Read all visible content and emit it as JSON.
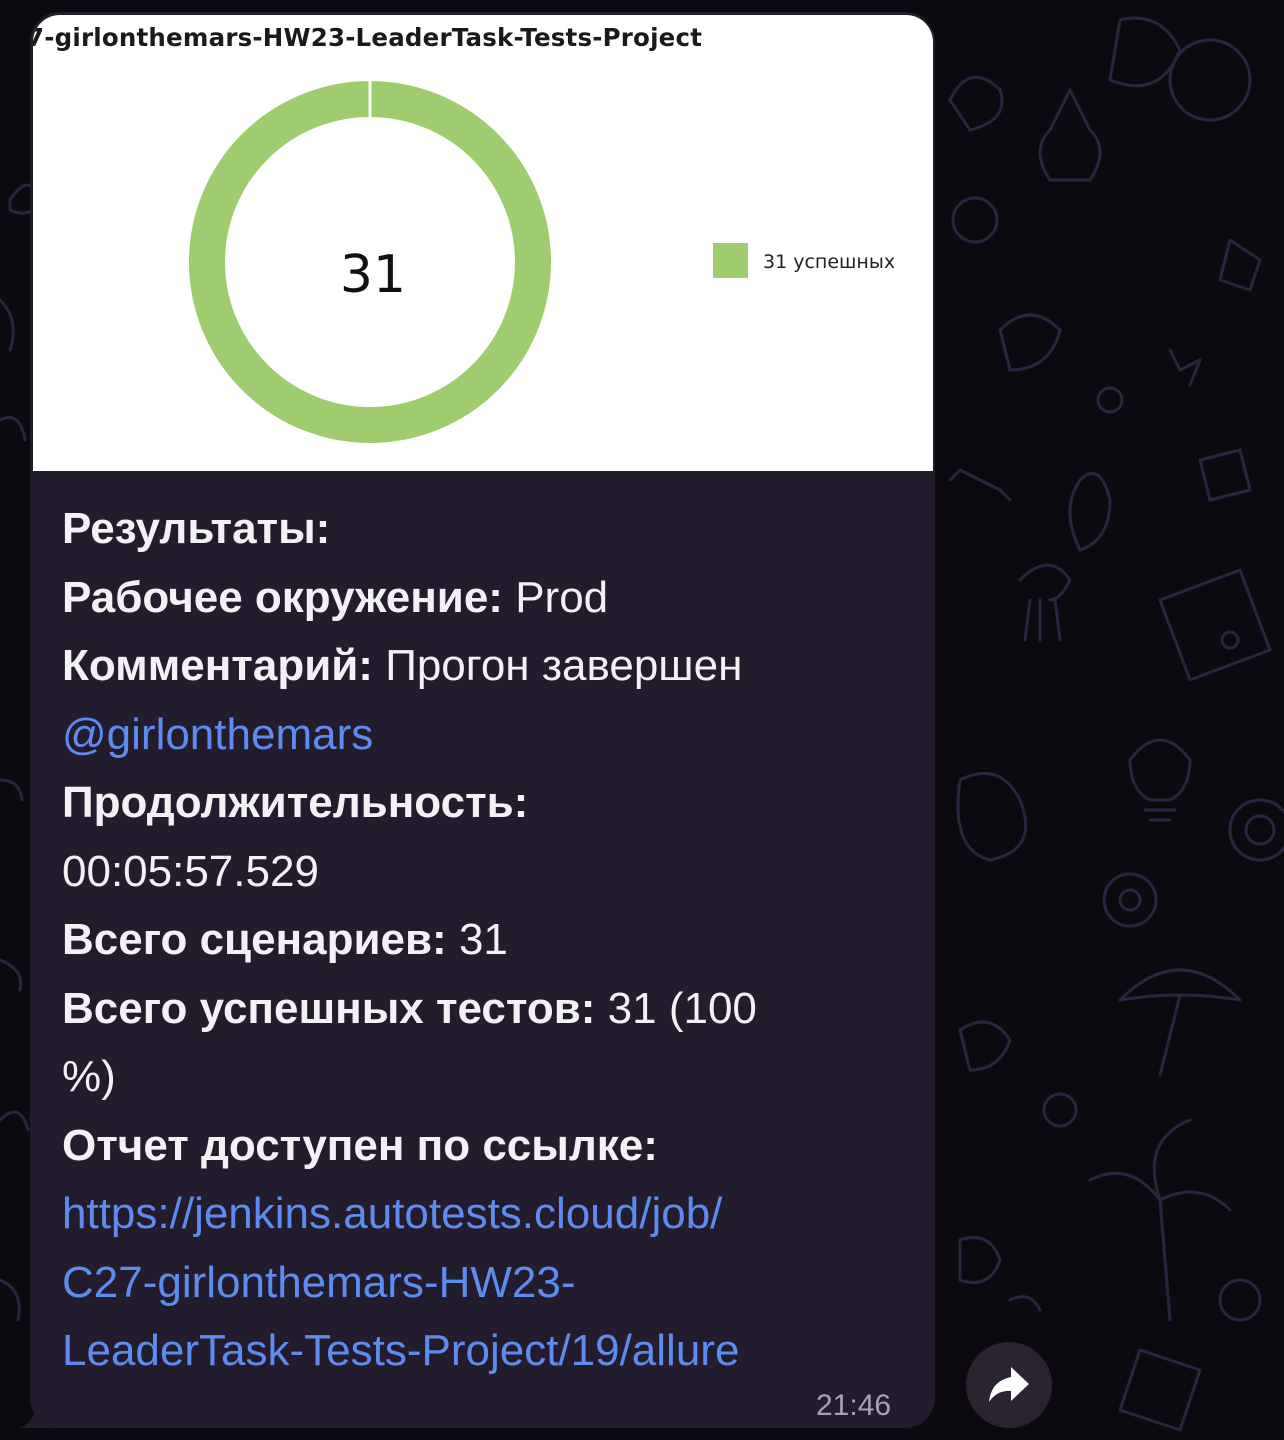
{
  "theme": {
    "background": "#0c0a10",
    "bubble_color": "#231c2c",
    "text_color": "#f3f1f6",
    "link_color": "#5d8cf0",
    "chart_green": "#9fcc6e"
  },
  "preview": {
    "title": "7-girlonthemars-HW23-LeaderTask-Tests-Project",
    "center_label": "31",
    "legend_label": "31 успешных"
  },
  "chart_data": {
    "type": "pie",
    "title": "7-girlonthemars-HW23-LeaderTask-Tests-Project",
    "center_text": "31",
    "series": [
      {
        "name": "31 успешных",
        "value": 31,
        "color": "#9fcc6e"
      }
    ],
    "legend_position": "right"
  },
  "message": {
    "results_label": "Результаты:",
    "env_label": "Рабочее окружение:",
    "env_value": "Prod",
    "comment_label": "Комментарий:",
    "comment_value": "Прогон завершен",
    "mention": "@girlonthemars",
    "duration_label": "Продолжительность:",
    "duration_value": "00:05:57.529",
    "scenarios_label": "Всего сценариев:",
    "scenarios_value": "31",
    "passed_label": "Всего успешных тестов:",
    "passed_value_part1": "31 (100",
    "passed_value_part2": "%)",
    "report_label": "Отчет доступен по ссылке:",
    "link_line1": "https://jenkins.autotests.cloud/job/",
    "link_line2": "C27-girlonthemars-HW23-",
    "link_line3": "LeaderTask-Tests-Project/19/allure",
    "time": "21:46"
  },
  "icons": {
    "share": "share-arrow-icon"
  }
}
